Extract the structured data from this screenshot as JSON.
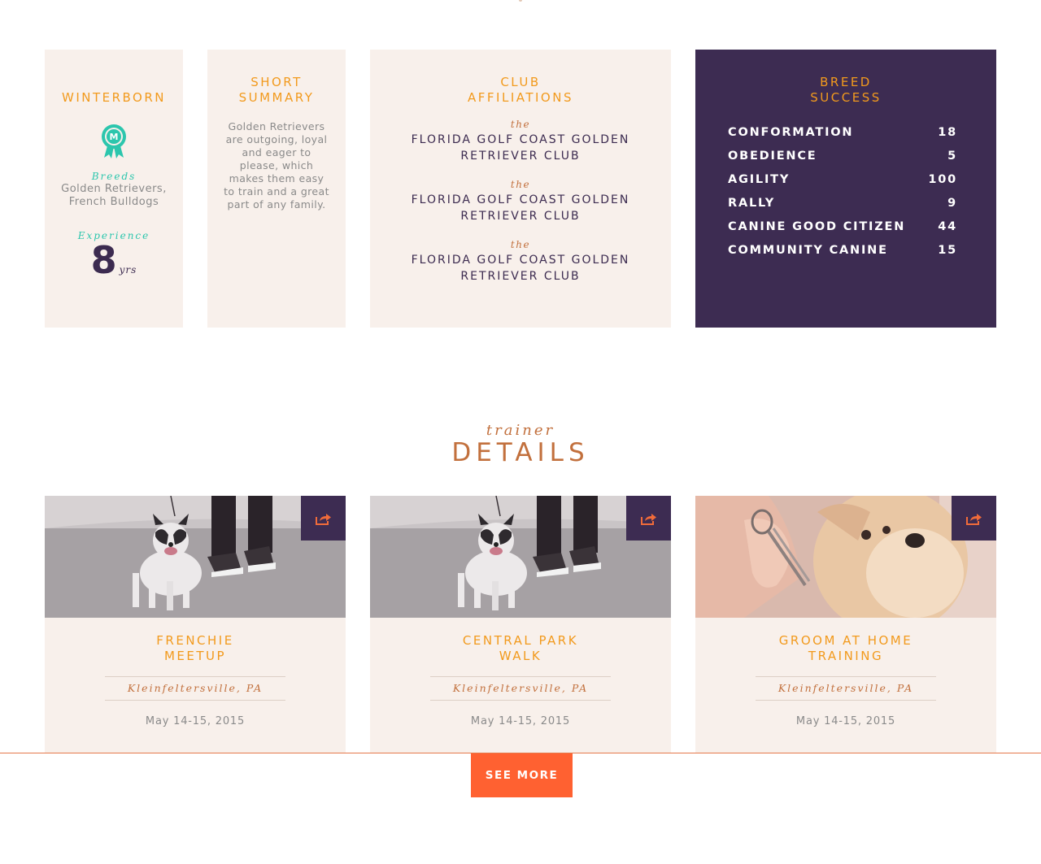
{
  "profile": {
    "name": "WINTERBORN",
    "ribbon_icon": "ribbon-award-icon",
    "ribbon_letter": "M",
    "breeds_label": "Breeds",
    "breeds_line1": "Golden Retrievers,",
    "breeds_line2": "French Bulldogs",
    "experience_label": "Experience",
    "experience_value": "8",
    "experience_unit": "yrs"
  },
  "summary": {
    "title_line1": "SHORT",
    "title_line2": "SUMMARY",
    "text": "Golden Retrievers are outgoing, loyal and eager to please, which makes them easy to train and a great part of any family."
  },
  "clubs": {
    "title_line1": "CLUB",
    "title_line2": "AFFILIATIONS",
    "items": [
      {
        "prefix": "the",
        "line1": "FLORIDA GOLF COAST GOLDEN",
        "line2": "RETRIEVER CLUB"
      },
      {
        "prefix": "the",
        "line1": "FLORIDA GOLF COAST GOLDEN",
        "line2": "RETRIEVER CLUB"
      },
      {
        "prefix": "the",
        "line1": "FLORIDA GOLF COAST GOLDEN",
        "line2": "RETRIEVER CLUB"
      }
    ]
  },
  "success": {
    "title_line1": "BREED",
    "title_line2": "SUCCESS",
    "stats": [
      {
        "label": "CONFORMATION",
        "value": "18"
      },
      {
        "label": "OBEDIENCE",
        "value": "5"
      },
      {
        "label": "AGILITY",
        "value": "100"
      },
      {
        "label": "RALLY",
        "value": "9"
      },
      {
        "label": "CANINE GOOD CITIZEN",
        "value": "44"
      },
      {
        "label": "COMMUNITY CANINE",
        "value": "15"
      }
    ]
  },
  "trainer": {
    "subtitle": "trainer",
    "title": "DETAILS"
  },
  "events": [
    {
      "title_line1": "FRENCHIE",
      "title_line2": "MEETUP",
      "location": "Kleinfeltersville, PA",
      "date": "May 14-15, 2015",
      "photo": "french-bulldog-walk-photo",
      "share_icon": "share-icon"
    },
    {
      "title_line1": "CENTRAL PARK",
      "title_line2": "WALK",
      "location": "Kleinfeltersville, PA",
      "date": "May 14-15, 2015",
      "photo": "french-bulldog-walk-photo",
      "share_icon": "share-icon"
    },
    {
      "title_line1": "GROOM AT HOME",
      "title_line2": "TRAINING",
      "location": "Kleinfeltersville, PA",
      "date": "May 14-15, 2015",
      "photo": "yorkshire-grooming-photo",
      "share_icon": "share-icon"
    }
  ],
  "see_more_label": "SEE MORE",
  "colors": {
    "accent_orange": "#f29a1d",
    "purple": "#3d2c52",
    "teal": "#2cc6ad",
    "rust": "#c2703d",
    "cta": "#ff6131",
    "card_bg": "#f8f0eb"
  }
}
